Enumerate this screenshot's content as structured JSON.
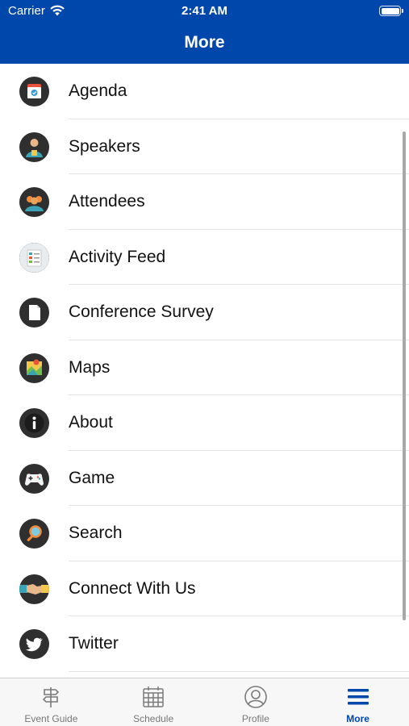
{
  "status_bar": {
    "carrier": "Carrier",
    "time": "2:41 AM"
  },
  "header": {
    "title": "More"
  },
  "menu": [
    {
      "label": "Agenda",
      "icon": "calendar-icon"
    },
    {
      "label": "Speakers",
      "icon": "speaker-icon"
    },
    {
      "label": "Attendees",
      "icon": "attendees-icon"
    },
    {
      "label": "Activity Feed",
      "icon": "activity-feed-icon"
    },
    {
      "label": "Conference Survey",
      "icon": "survey-icon"
    },
    {
      "label": "Maps",
      "icon": "map-icon"
    },
    {
      "label": "About",
      "icon": "info-icon"
    },
    {
      "label": "Game",
      "icon": "game-controller-icon"
    },
    {
      "label": "Search",
      "icon": "search-icon"
    },
    {
      "label": "Connect With Us",
      "icon": "handshake-icon"
    },
    {
      "label": "Twitter",
      "icon": "twitter-icon"
    }
  ],
  "tabs": [
    {
      "label": "Event Guide",
      "icon": "signpost-icon",
      "active": false
    },
    {
      "label": "Schedule",
      "icon": "calendar-grid-icon",
      "active": false
    },
    {
      "label": "Profile",
      "icon": "profile-icon",
      "active": false
    },
    {
      "label": "More",
      "icon": "hamburger-menu-icon",
      "active": true
    }
  ],
  "colors": {
    "brand": "#0047AB",
    "inactive_tab": "#777777"
  }
}
